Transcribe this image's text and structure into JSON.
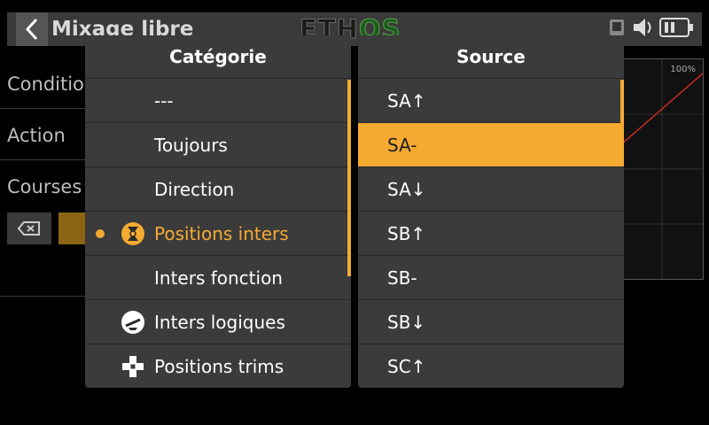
{
  "header": {
    "title": "Mixage libre",
    "logo_part1": "ETH",
    "logo_part2": "OS"
  },
  "background_labels": {
    "conditions": "Conditio",
    "action": "Action",
    "courses": "Courses",
    "graph_max": "100%"
  },
  "category_panel": {
    "title": "Catégorie",
    "items": [
      {
        "label": "---",
        "icon": ""
      },
      {
        "label": "Toujours",
        "icon": ""
      },
      {
        "label": "Direction",
        "icon": ""
      },
      {
        "label": "Positions inters",
        "icon": "switch-positions-icon",
        "active": true
      },
      {
        "label": "Inters fonction",
        "icon": ""
      },
      {
        "label": "Inters logiques",
        "icon": "logic-switch-icon"
      },
      {
        "label": "Positions trims",
        "icon": "trim-positions-icon"
      }
    ]
  },
  "source_panel": {
    "title": "Source",
    "items": [
      {
        "label": "SA↑"
      },
      {
        "label": "SA-",
        "selected": true
      },
      {
        "label": "SA↓"
      },
      {
        "label": "SB↑"
      },
      {
        "label": "SB-"
      },
      {
        "label": "SB↓"
      },
      {
        "label": "SC↑"
      }
    ]
  },
  "colors": {
    "accent": "#f5aa32",
    "panel_bg": "#3b3b3b",
    "row_divider": "#272727",
    "background": "#000000"
  }
}
